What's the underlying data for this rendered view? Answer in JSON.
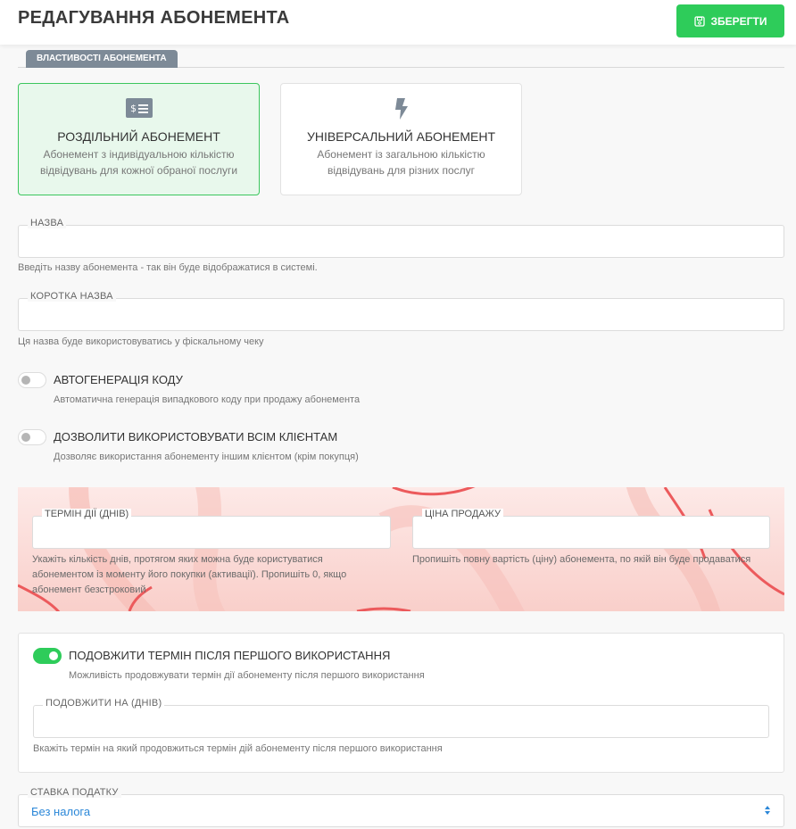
{
  "header": {
    "title": "РЕДАГУВАННЯ АБОНЕМЕНТА",
    "save_label": "ЗБЕРЕГТИ"
  },
  "tabs": [
    {
      "label": "ВЛАСТИВОСТІ АБОНЕМЕНТА",
      "active": true
    }
  ],
  "type_cards": [
    {
      "icon": "money-bill-icon",
      "title": "РОЗДІЛЬНИЙ АБОНЕМЕНТ",
      "desc_line1": "Абонемент з індивідуальною кількістю",
      "desc_line2": "відвідувань для кожної обраної послуги",
      "selected": true
    },
    {
      "icon": "bolt-icon",
      "title": "УНІВЕРСАЛЬНИЙ АБОНЕМЕНТ",
      "desc_line1": "Абонемент із загальною кількістю",
      "desc_line2": "відвідувань для різних послуг",
      "selected": false
    }
  ],
  "fields": {
    "name": {
      "label": "НАЗВА",
      "value": "",
      "hint": "Введіть назву абонемента - так він буде відображатися в системі."
    },
    "short_name": {
      "label": "КОРОТКА НАЗВА",
      "value": "",
      "hint": "Ця назва буде використовуватись у фіскальному чеку"
    },
    "validity_days": {
      "label": "ТЕРМІН ДІЇ (ДНІВ)",
      "value": "",
      "hint_line1": "Укажіть кількість днів, протягом яких можна буде користуватися",
      "hint_line2": "абонементом із моменту його покупки (активації). Пропишіть 0, якщо",
      "hint_line3": "абонемент безстроковий"
    },
    "sale_price": {
      "label": "ЦІНА ПРОДАЖУ",
      "value": "",
      "hint": "Пропишіть повну вартість (ціну) абонемента, по якій він буде продаватися"
    },
    "extend_days": {
      "label": "ПОДОВЖИТИ НА (ДНІВ)",
      "value": "",
      "hint": "Вкажіть термін на який продовжиться термін дій абонементу після першого використання"
    },
    "tax_rate": {
      "label": "СТАВКА ПОДАТКУ",
      "value": "Без налога"
    }
  },
  "toggles": {
    "autogen": {
      "label": "АВТОГЕНЕРАЦІЯ КОДУ",
      "desc": "Автоматична генерація випадкового коду при продажу абонемента",
      "on": false
    },
    "all_clients": {
      "label": "ДОЗВОЛИТИ ВИКОРИСТОВУВАТИ ВСІМ КЛІЄНТАМ",
      "desc": "Дозволяє використання абонементу іншим клієнтом (крім покупця)",
      "on": false
    },
    "extend_after_first": {
      "label": "ПОДОВЖИТИ ТЕРМІН ПІСЛЯ ПЕРШОГО ВИКОРИСТАННЯ",
      "desc": "Можливість продовжувати термін дії абонементу після першого використання",
      "on": true
    }
  },
  "colors": {
    "accent_green": "#2ecc5a",
    "link_blue": "#2b87d8",
    "promo_bg": "#fbdcd8",
    "deco_red": "#ec5a5c"
  }
}
